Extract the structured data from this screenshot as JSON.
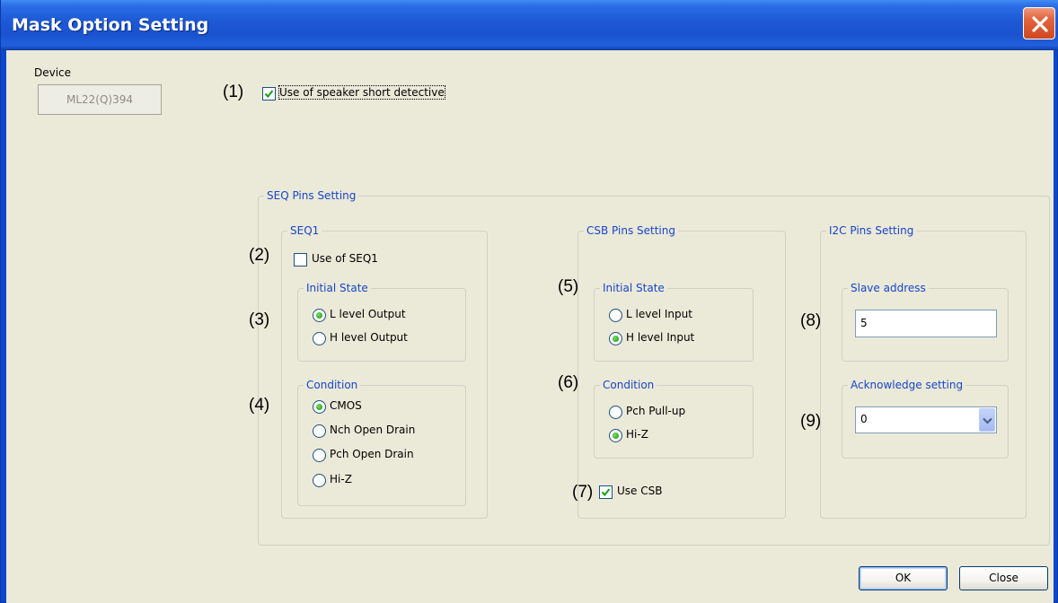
{
  "window": {
    "title": "Mask Option Setting"
  },
  "device": {
    "label": "Device",
    "value": "ML22(Q)394"
  },
  "speaker": {
    "number": "(1)",
    "label": "Use of speaker short detective",
    "checked": true
  },
  "seq_pins": {
    "title": "SEQ Pins Setting",
    "seq1": {
      "title": "SEQ1",
      "use": {
        "number": "(2)",
        "label": "Use of SEQ1",
        "checked": false
      },
      "initial_state": {
        "number": "(3)",
        "title": "Initial State",
        "options": [
          "L level Output",
          "H level Output"
        ],
        "selected": "L level Output"
      },
      "condition": {
        "number": "(4)",
        "title": "Condition",
        "options": [
          "CMOS",
          "Nch Open Drain",
          "Pch Open Drain",
          "Hi-Z"
        ],
        "selected": "CMOS"
      }
    },
    "csb": {
      "title": "CSB Pins Setting",
      "initial_state": {
        "number": "(5)",
        "title": "Initial State",
        "options": [
          "L level Input",
          "H level Input"
        ],
        "selected": "H level Input"
      },
      "condition": {
        "number": "(6)",
        "title": "Condition",
        "options": [
          "Pch Pull-up",
          "Hi-Z"
        ],
        "selected": "Hi-Z"
      },
      "use": {
        "number": "(7)",
        "label": "Use CSB",
        "checked": true
      }
    },
    "i2c": {
      "title": "I2C Pins Setting",
      "slave": {
        "number": "(8)",
        "title": "Slave address",
        "value": "5"
      },
      "ack": {
        "number": "(9)",
        "title": "Acknowledge setting",
        "value": "0"
      }
    }
  },
  "buttons": {
    "ok": "OK",
    "close": "Close"
  },
  "colors": {
    "title_bar": "#1e5ad6",
    "group_title": "#1646c8",
    "radio_selected": "#2ea51a",
    "checkmark": "#21a121",
    "close_button": "#e2663f"
  }
}
